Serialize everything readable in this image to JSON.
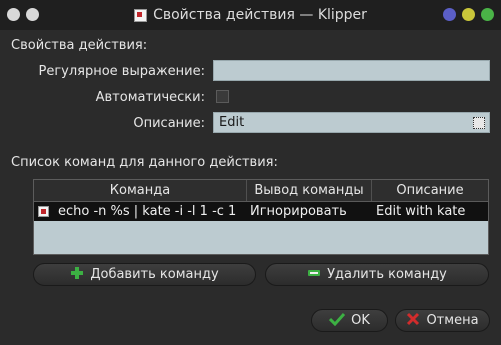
{
  "window": {
    "title": "Свойства действия — Klipper",
    "button_colors": [
      "#5b5fc7",
      "#c9c63a",
      "#4ab347"
    ]
  },
  "section": {
    "title": "Свойства действия:"
  },
  "regex": {
    "label": "Регулярное выражение:",
    "value": ""
  },
  "automatic": {
    "label": "Автоматически:",
    "checked": false
  },
  "description": {
    "label": "Описание:",
    "value": "Edit"
  },
  "commands": {
    "title": "Список команд для данного действия:",
    "columns": [
      "Команда",
      "Вывод команды",
      "Описание"
    ],
    "rows": [
      {
        "command": "echo -n %s | kate -i -l 1 -c 1",
        "output": "Игнорировать",
        "description": "Edit with kate"
      }
    ],
    "add_label": "Добавить команду",
    "remove_label": "Удалить команду"
  },
  "dialog": {
    "ok_label": "OK",
    "cancel_label": "Отмена"
  }
}
